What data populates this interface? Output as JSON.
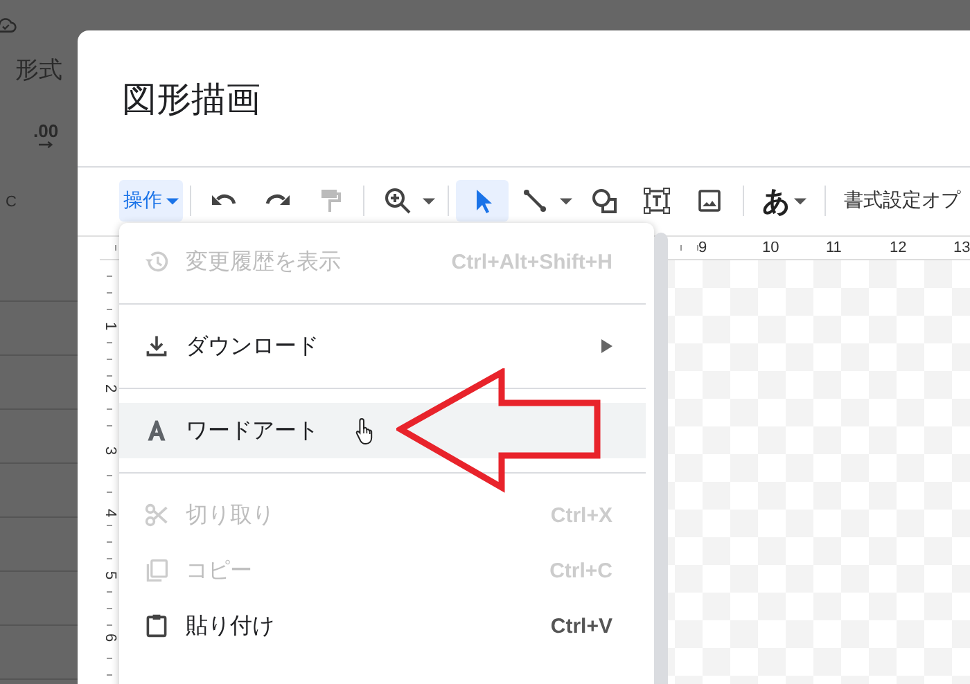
{
  "background_sheet": {
    "menu_fragment": "形式",
    "format_buttons": [
      ".00"
    ],
    "column_header": "C"
  },
  "dialog": {
    "title": "図形描画"
  },
  "toolbar": [
    {
      "kind": "menu",
      "label": "操作",
      "selected": true
    },
    {
      "kind": "sep"
    },
    {
      "kind": "undo",
      "disabled": false
    },
    {
      "kind": "redo",
      "disabled": false
    },
    {
      "kind": "paint",
      "disabled": true
    },
    {
      "kind": "sep"
    },
    {
      "kind": "zoom"
    },
    {
      "kind": "sep"
    },
    {
      "kind": "select",
      "selected": true
    },
    {
      "kind": "line"
    },
    {
      "kind": "shape"
    },
    {
      "kind": "textbox"
    },
    {
      "kind": "image"
    },
    {
      "kind": "sep"
    },
    {
      "kind": "glyph",
      "label": "あ"
    },
    {
      "kind": "sep"
    },
    {
      "kind": "text",
      "label": "書式設定オプ"
    }
  ],
  "ruler": {
    "top_numbers": [
      "9",
      "10",
      "11",
      "12",
      "13"
    ],
    "side_numbers": [
      "1",
      "2",
      "3",
      "4",
      "5",
      "6"
    ]
  },
  "menu": {
    "sections": [
      [
        {
          "kind": "history",
          "label": "変更履歴を表示",
          "shortcut": "Ctrl+Alt+Shift+H",
          "disabled": true,
          "highlighted": false,
          "submenu": false
        }
      ],
      [
        {
          "kind": "download",
          "label": "ダウンロード",
          "disabled": false,
          "highlighted": false,
          "submenu": true
        }
      ],
      [
        {
          "kind": "wordart",
          "label": "ワードアート",
          "disabled": false,
          "highlighted": true,
          "submenu": false
        }
      ],
      [
        {
          "kind": "cut",
          "label": "切り取り",
          "shortcut": "Ctrl+X",
          "disabled": true,
          "highlighted": false,
          "submenu": false
        },
        {
          "kind": "copy",
          "label": "コピー",
          "shortcut": "Ctrl+C",
          "disabled": true,
          "highlighted": false,
          "submenu": false
        },
        {
          "kind": "paste",
          "label": "貼り付け",
          "shortcut": "Ctrl+V",
          "disabled": false,
          "highlighted": false,
          "submenu": false
        }
      ]
    ]
  }
}
